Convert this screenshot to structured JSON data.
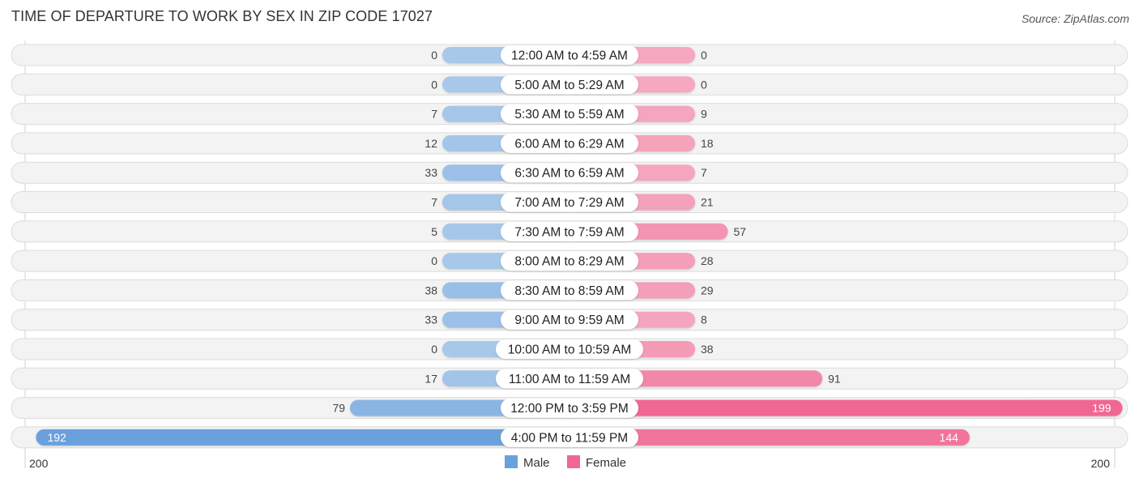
{
  "header": {
    "title": "TIME OF DEPARTURE TO WORK BY SEX IN ZIP CODE 17027",
    "source": "Source: ZipAtlas.com"
  },
  "chart_data": {
    "type": "bar",
    "orientation": "horizontal-diverging",
    "title": "TIME OF DEPARTURE TO WORK BY SEX IN ZIP CODE 17027",
    "categories": [
      "12:00 AM to 4:59 AM",
      "5:00 AM to 5:29 AM",
      "5:30 AM to 5:59 AM",
      "6:00 AM to 6:29 AM",
      "6:30 AM to 6:59 AM",
      "7:00 AM to 7:29 AM",
      "7:30 AM to 7:59 AM",
      "8:00 AM to 8:29 AM",
      "8:30 AM to 8:59 AM",
      "9:00 AM to 9:59 AM",
      "10:00 AM to 10:59 AM",
      "11:00 AM to 11:59 AM",
      "12:00 PM to 3:59 PM",
      "4:00 PM to 11:59 PM"
    ],
    "series": [
      {
        "name": "Male",
        "color": "#6aa1dc",
        "light_color": "#a8c8ea",
        "values": [
          0,
          0,
          7,
          12,
          33,
          7,
          5,
          0,
          38,
          33,
          0,
          17,
          79,
          192
        ]
      },
      {
        "name": "Female",
        "color": "#f06892",
        "light_color": "#f5a8c0",
        "values": [
          0,
          0,
          9,
          18,
          7,
          21,
          57,
          28,
          29,
          8,
          38,
          91,
          199,
          144
        ]
      }
    ],
    "xlim": [
      -200,
      200
    ],
    "axis_labels": {
      "left": "200",
      "right": "200"
    },
    "legend": {
      "position": "bottom-center",
      "entries": [
        "Male",
        "Female"
      ]
    },
    "xlabel": "",
    "ylabel": ""
  }
}
